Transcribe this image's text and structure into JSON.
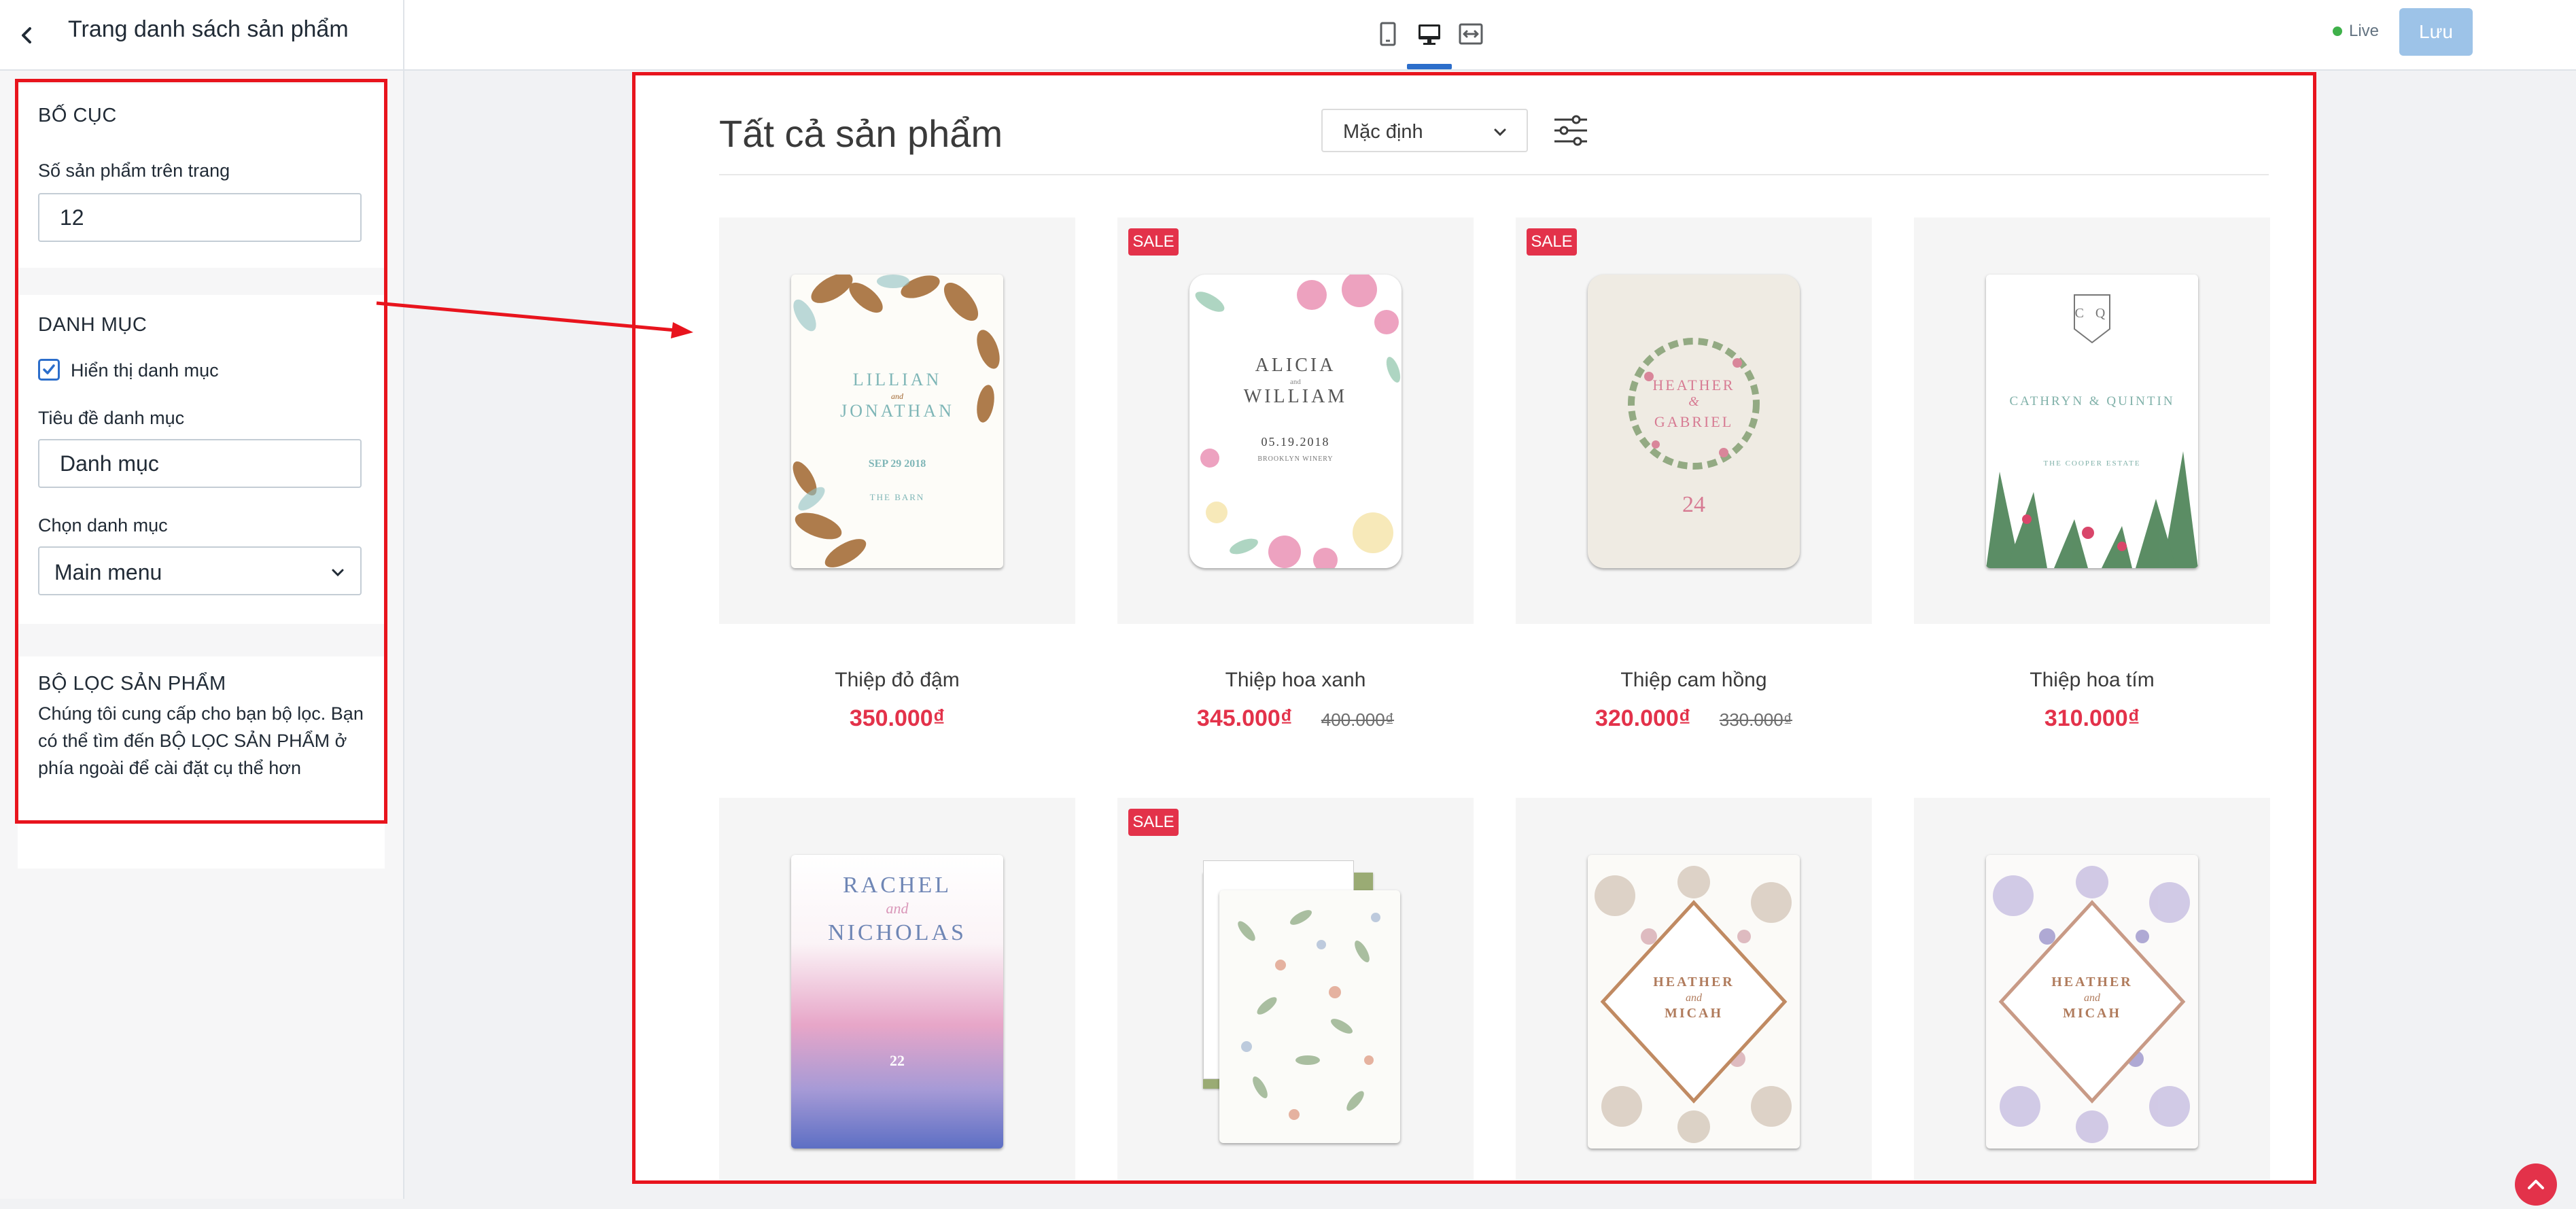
{
  "header": {
    "page_name": "Trang danh sách sản phẩm",
    "live_label": "Live",
    "save_label": "Lưu",
    "device_modes": [
      "mobile",
      "desktop",
      "full-width"
    ],
    "active_device": "desktop"
  },
  "sidebar": {
    "layout": {
      "title": "BỐ CỤC",
      "per_page_label": "Số sản phẩm trên trang",
      "per_page_value": "12"
    },
    "category": {
      "title": "DANH MỤC",
      "show_checkbox_label": "Hiển thị danh mục",
      "show_checked": true,
      "heading_label": "Tiêu đề danh mục",
      "heading_value": "Danh mục",
      "menu_label": "Chọn danh mục",
      "menu_value": "Main menu"
    },
    "filter": {
      "title": "BỘ LỌC SẢN PHẨM",
      "description": "Chúng tôi cung cấp cho bạn bộ lọc. Bạn có thể tìm đến BỘ LỌC SẢN PHẨM ở phía ngoài để cài đặt cụ thể hơn"
    }
  },
  "preview": {
    "title": "Tất cả sản phẩm",
    "sort_value": "Mặc định",
    "sale_label": "SALE",
    "products": [
      {
        "name": "Thiệp đỏ đậm",
        "price": "350.000₫",
        "old_price": "",
        "sale": false,
        "invite_text": [
          "LILLIAN",
          "and",
          "JONATHAN",
          "SEP 29 2018",
          "THE BARN"
        ]
      },
      {
        "name": "Thiệp hoa xanh",
        "price": "345.000₫",
        "old_price": "400.000₫",
        "sale": true,
        "invite_text": [
          "ALICIA",
          "and",
          "WILLIAM",
          "05.19.2018",
          "BROOKLYN WINERY"
        ]
      },
      {
        "name": "Thiệp cam hồng",
        "price": "320.000₫",
        "old_price": "330.000₫",
        "sale": true,
        "invite_text": [
          "HEATHER",
          "&",
          "GABRIEL",
          "24"
        ]
      },
      {
        "name": "Thiệp hoa tím",
        "price": "310.000₫",
        "old_price": "",
        "sale": false,
        "invite_text": [
          "C Q",
          "CATHRYN & QUINTIN",
          "THE COOPER ESTATE"
        ]
      },
      {
        "name": "",
        "price": "",
        "old_price": "",
        "sale": false,
        "invite_text": [
          "RACHEL",
          "and",
          "NICHOLAS",
          "22"
        ]
      },
      {
        "name": "",
        "price": "",
        "old_price": "",
        "sale": true,
        "invite_text": []
      },
      {
        "name": "",
        "price": "",
        "old_price": "",
        "sale": false,
        "invite_text": [
          "HEATHER",
          "and",
          "MICAH"
        ]
      },
      {
        "name": "",
        "price": "",
        "old_price": "",
        "sale": false,
        "invite_text": [
          "HEATHER",
          "and",
          "MICAH"
        ]
      }
    ]
  },
  "colors": {
    "accent": "#2c6ecb",
    "sale": "#e3324a",
    "annotation": "#e8141d",
    "save_button": "#9dc3e8"
  }
}
